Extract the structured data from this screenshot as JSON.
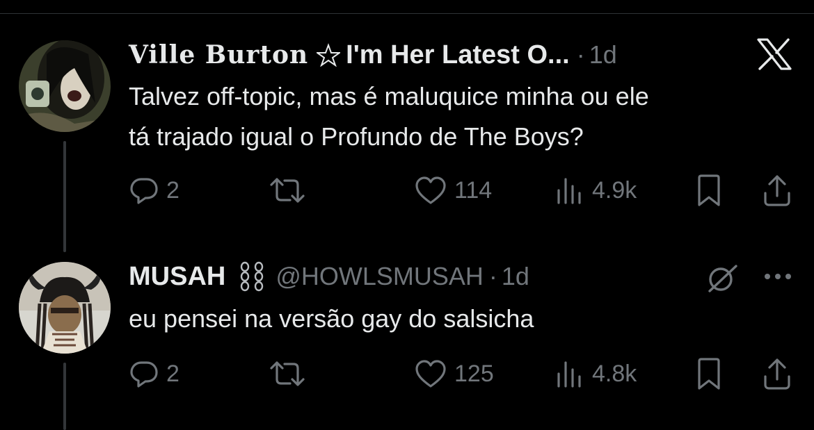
{
  "tweets": [
    {
      "display_name": "Ville Burton",
      "name_suffix": "I'm Her Latest O...",
      "separator": "·",
      "time": "1d",
      "text_line1": "Talvez off-topic, mas é maluquice minha ou ele",
      "text_line2": "tá trajado igual o Profundo de The Boys?",
      "replies": "2",
      "likes": "114",
      "views": "4.9k",
      "header_icon": "x-logo-icon"
    },
    {
      "display_name": "MUSAH",
      "handle": "@HOWLSMUSAH",
      "separator": "·",
      "time": "1d",
      "text": "eu pensei na versão gay do salsicha",
      "replies": "2",
      "likes": "125",
      "views": "4.8k",
      "header_icon": "grok-icon"
    }
  ],
  "colors": {
    "background": "#000000",
    "text": "#e7e9ea",
    "muted": "#71767b",
    "thread_line": "#333639"
  }
}
